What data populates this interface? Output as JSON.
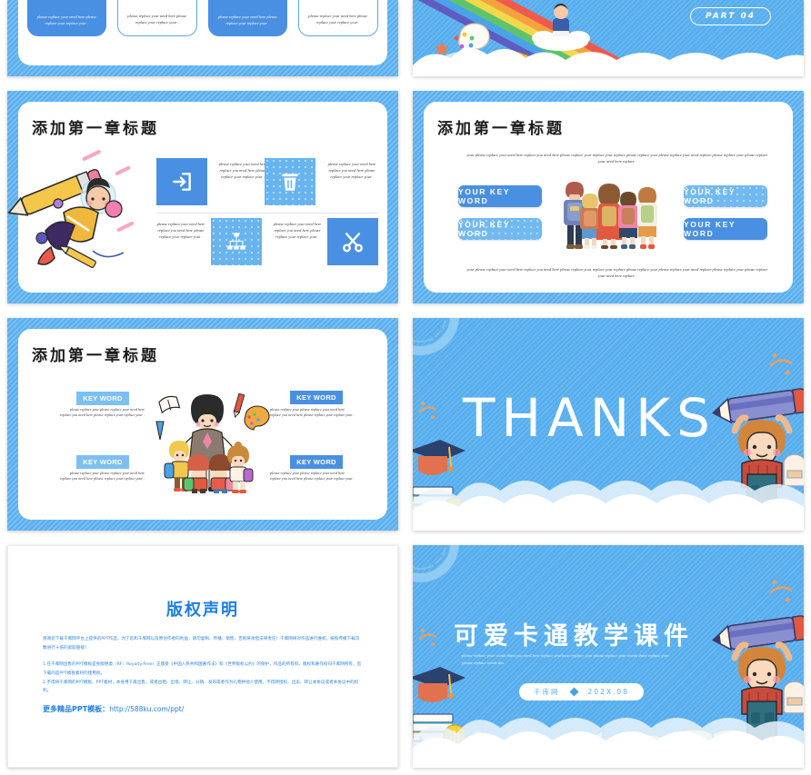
{
  "meta": {
    "deck_name": "可爱卡通教学课件",
    "accent_blue": "#4a90e2",
    "light_blue": "#68b4ee",
    "sky_blue": "#57aeee",
    "link_blue": "#1e7ee6"
  },
  "slide_cards_top": {
    "cards": [
      {
        "text": "please replace your need here please replace your replace your ."
      },
      {
        "text": "please replace your need here please replace your replace your ."
      },
      {
        "text": "please replace your need here please replace your replace your ."
      },
      {
        "text": "please replace your need here please replace your replace your ."
      }
    ]
  },
  "slide_part_cover": {
    "badge_label": "PART 04"
  },
  "slide_icons": {
    "title": "添加第一章标题",
    "items": [
      {
        "icon": "login-arrow-icon",
        "text": "please replace your need here replace you need here please replace your replace your ."
      },
      {
        "icon": "trash-icon",
        "text": "please replace your need here replace you need here please replace your replace your ."
      },
      {
        "icon": "hierarchy-icon",
        "text": "please replace your need here replace you need here please replace your replace your ."
      },
      {
        "icon": "scissors-icon",
        "text": "please replace your need here replace you need here please replace your replace your ."
      }
    ]
  },
  "slide_keywords": {
    "title": "添加第一章标题",
    "paragraph_top": "your please replace your need here replace you need here please replace your replace your replace please replace your please replace your need replace please replace your please replace your need here replace .",
    "paragraph_bottom": "your please replace your need here replace you need here please replace your replace your replace please replace your please replace your need replace please replace your please replace your need here replace .",
    "pills": [
      {
        "label": "YOUR KEY WORD",
        "style": "dark"
      },
      {
        "label": "YOUR KEY WORD",
        "style": "light"
      },
      {
        "label": "YOUR KEY WORD",
        "style": "light"
      },
      {
        "label": "YOUR KEY WORD",
        "style": "dark"
      }
    ]
  },
  "slide_teacher": {
    "title": "添加第一章标题",
    "blocks": [
      {
        "label": "KEY WORD",
        "style": "light",
        "text": "please replace your please replace your need here replace you need here please replace your replace your ."
      },
      {
        "label": "KEY WORD",
        "style": "light",
        "text": "please replace your please replace your need here replace you need here please replace your replace your ."
      },
      {
        "label": "KEY WORD",
        "style": "dark",
        "text": "please replace your please replace your need here replace you need here please replace your replace your ."
      },
      {
        "label": "KEY WORD",
        "style": "dark",
        "text": "please replace your please replace your need here replace you need here please replace your replace your ."
      }
    ]
  },
  "slide_thanks": {
    "word": "THANKS"
  },
  "slide_copyright": {
    "title": "版权声明",
    "paragraph_1": "感谢您下载千库网平台上提供的PPT作品，为了您和千库网以及原创作者的利益，请勿复制、传播、销售，否则将承担法律责任！千库网将对作品进行维权，按照传播下载次数进行十倍的索取赔偿！",
    "paragraph_2": "1.在千库网出售的PPT模板是免版税类（RF：Royalty-Free）正版受《中国人民共和国著作法》和《世界版权公约》的保护，作品的所有权、版权和著作权归千库网所有，您下载的是PPT模板素材的使用权。",
    "paragraph_3": "2.不得将千库网的PPT模板、PPT素材，本身用于再出售，或者出租、出借、转让、分销、发布或者作为礼物供他人使用，不得转授权、出卖、转让本协议或者本协议中的权利。",
    "link_label": "更多精品PPT模板：",
    "link_url": "http://588ku.com/ppt/"
  },
  "slide_cover": {
    "title": "可爱卡通教学课件",
    "subtitle": "please replace your words thant you need here replace yourlease replace your please replace your words thant replace your please replace words tha.",
    "source": "千库网",
    "date": "202X.08"
  }
}
